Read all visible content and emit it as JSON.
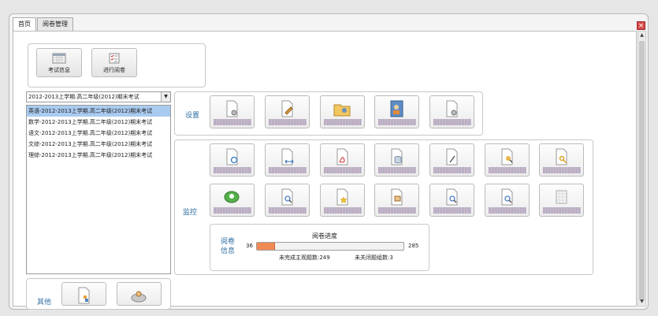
{
  "tabs": [
    {
      "label": "首页",
      "active": true
    },
    {
      "label": "阅卷管理",
      "active": false
    }
  ],
  "close_glyph": "×",
  "top_buttons": {
    "exam_info": {
      "label": "考试信息",
      "icon": "calendar-icon"
    },
    "grading": {
      "label": "进行阅卷",
      "icon": "checklist-icon"
    }
  },
  "exam_select": {
    "value": "2012-2013上学期.高二年级(2012)期末考试",
    "arrow": "▼"
  },
  "exam_list": [
    "英语-2012-2013上学期.高二年级(2012)期末考试",
    "数学-2012-2013上学期.高二年级(2012)期末考试",
    "语文-2012-2013上学期.高二年级(2012)期末考试",
    "文综-2012-2013上学期.高二年级(2012)期末考试",
    "理综-2012-2013上学期.高二年级(2012)期末考试"
  ],
  "sections": {
    "settings": "设置",
    "monitor": "监控",
    "other": "其他"
  },
  "settings_tiles": [
    {
      "icon": "doc-gear-icon"
    },
    {
      "icon": "doc-pencil-icon"
    },
    {
      "icon": "folder-user-icon"
    },
    {
      "icon": "contacts-book-icon"
    },
    {
      "icon": "doc-gear-icon"
    }
  ],
  "monitor_tiles": [
    {
      "icon": "doc-refresh-icon"
    },
    {
      "icon": "doc-arrows-icon"
    },
    {
      "icon": "pdf-icon"
    },
    {
      "icon": "doc-database-icon"
    },
    {
      "icon": "doc-pen-icon"
    },
    {
      "icon": "doc-user-search-icon"
    },
    {
      "icon": "doc-key-icon"
    },
    {
      "icon": "green-check-disc-icon"
    },
    {
      "icon": "doc-search-icon"
    },
    {
      "icon": "doc-star-icon"
    },
    {
      "icon": "doc-image-icon"
    },
    {
      "icon": "doc-search-icon"
    },
    {
      "icon": "doc-search-icon"
    },
    {
      "icon": "blank-doc-icon"
    }
  ],
  "other_tiles": [
    {
      "icon": "doc-share-icon"
    },
    {
      "icon": "user-disk-icon"
    }
  ],
  "progress": {
    "label_line1": "阅卷",
    "label_line2": "信息",
    "title": "阅卷进度",
    "min": "36",
    "max": "285",
    "value_fraction": 0.1263,
    "unfinished": "未完成主观题数:249",
    "unclosed": "未关闭题组数:3"
  },
  "colors": {
    "accent": "#2f6fa4",
    "progress_fill": "#f08a54",
    "selection": "#aacbf0"
  }
}
